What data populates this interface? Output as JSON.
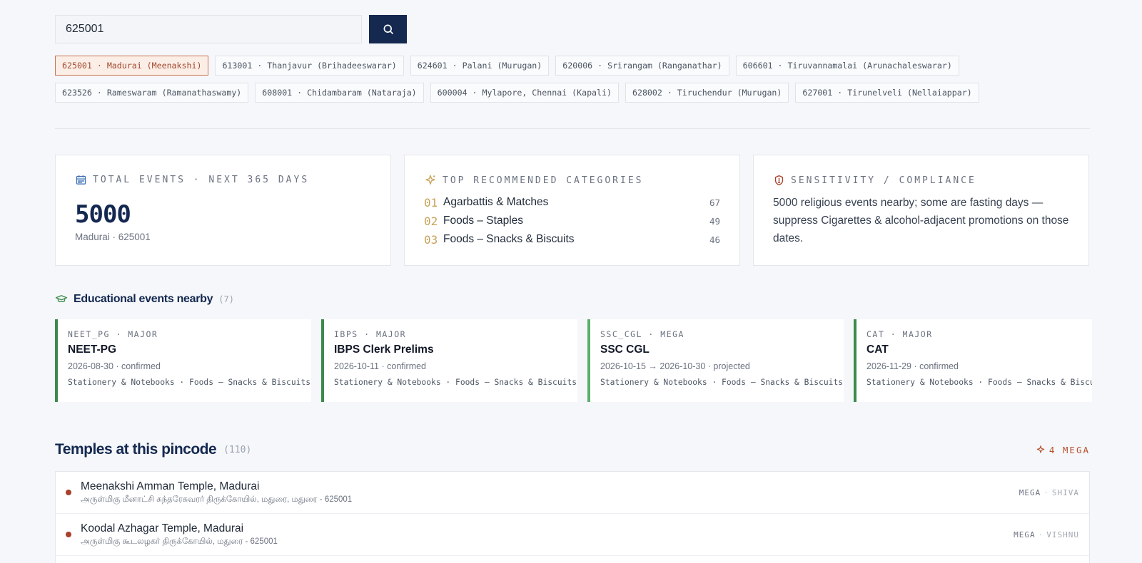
{
  "search": {
    "value": "625001"
  },
  "colors": {
    "navy": "#142850",
    "accent": "#a2482b",
    "green": "#3d8a4e",
    "gold": "#c8a35a"
  },
  "chips": [
    [
      {
        "label": "625001 · Madurai (Meenakshi)",
        "active": true
      },
      {
        "label": "613001 · Thanjavur (Brihadeeswarar)"
      },
      {
        "label": "624601 · Palani (Murugan)"
      },
      {
        "label": "620006 · Srirangam (Ranganathar)"
      },
      {
        "label": "606601 · Tiruvannamalai (Arunachaleswarar)"
      }
    ],
    [
      {
        "label": "623526 · Rameswaram (Ramanathaswamy)"
      },
      {
        "label": "608001 · Chidambaram (Nataraja)"
      },
      {
        "label": "600004 · Mylapore, Chennai (Kapali)"
      },
      {
        "label": "628002 · Tiruchendur (Murugan)"
      },
      {
        "label": "627001 · Tirunelveli (Nellaiappar)"
      }
    ]
  ],
  "stats": {
    "total": {
      "heading": "TOTAL EVENTS · NEXT 365 DAYS",
      "value": "5000",
      "sub": "Madurai · 625001",
      "icon": "calendar-icon"
    },
    "categories": {
      "heading": "TOP RECOMMENDED CATEGORIES",
      "icon": "sparkle-icon",
      "items": [
        {
          "rank": "01",
          "name": "Agarbattis & Matches",
          "count": "67"
        },
        {
          "rank": "02",
          "name": "Foods – Staples",
          "count": "49"
        },
        {
          "rank": "03",
          "name": "Foods – Snacks & Biscuits",
          "count": "46"
        }
      ]
    },
    "sensitivity": {
      "heading": "SENSITIVITY / COMPLIANCE",
      "icon": "shield-alert-icon",
      "text": "5000 religious events nearby; some are fasting days — suppress Cigarettes & alcohol-adjacent promotions on those dates."
    }
  },
  "education": {
    "title": "Educational events nearby",
    "count": "(7)",
    "icon": "graduation-cap-icon",
    "cards": [
      {
        "tag": "NEET_PG · MAJOR",
        "name": "NEET-PG",
        "date": "2026-08-30 · confirmed",
        "cats": "Stationery & Notebooks · Foods – Snacks & Biscuits"
      },
      {
        "tag": "IBPS · MAJOR",
        "name": "IBPS Clerk Prelims",
        "date": "2026-10-11 · confirmed",
        "cats": "Stationery & Notebooks · Foods – Snacks & Biscuits"
      },
      {
        "tag": "SSC_CGL · MEGA",
        "name": "SSC CGL",
        "date": "2026-10-15 → 2026-10-30 · projected",
        "cats": "Stationery & Notebooks · Foods – Snacks & Biscuits"
      },
      {
        "tag": "CAT · MAJOR",
        "name": "CAT",
        "date": "2026-11-29 · confirmed",
        "cats": "Stationery & Notebooks · Foods – Snacks & Biscuits"
      }
    ]
  },
  "temples": {
    "title": "Temples at this pincode",
    "count": "(110)",
    "mega_label": "4 MEGA",
    "items": [
      {
        "name": "Meenakshi Amman Temple, Madurai",
        "tamil": "அருள்மிகு மீனாட்சி சுந்தரேசுவரர் திருக்கோயில், மதுரை, மதுரை - 625001",
        "tier": "MEGA",
        "deity": "SHIVA"
      },
      {
        "name": "Koodal Azhagar Temple, Madurai",
        "tamil": "அருள்மிகு கூடலழகர் திருக்கோயில், மதுரை - 625001",
        "tier": "MEGA",
        "deity": "VISHNU"
      }
    ]
  }
}
